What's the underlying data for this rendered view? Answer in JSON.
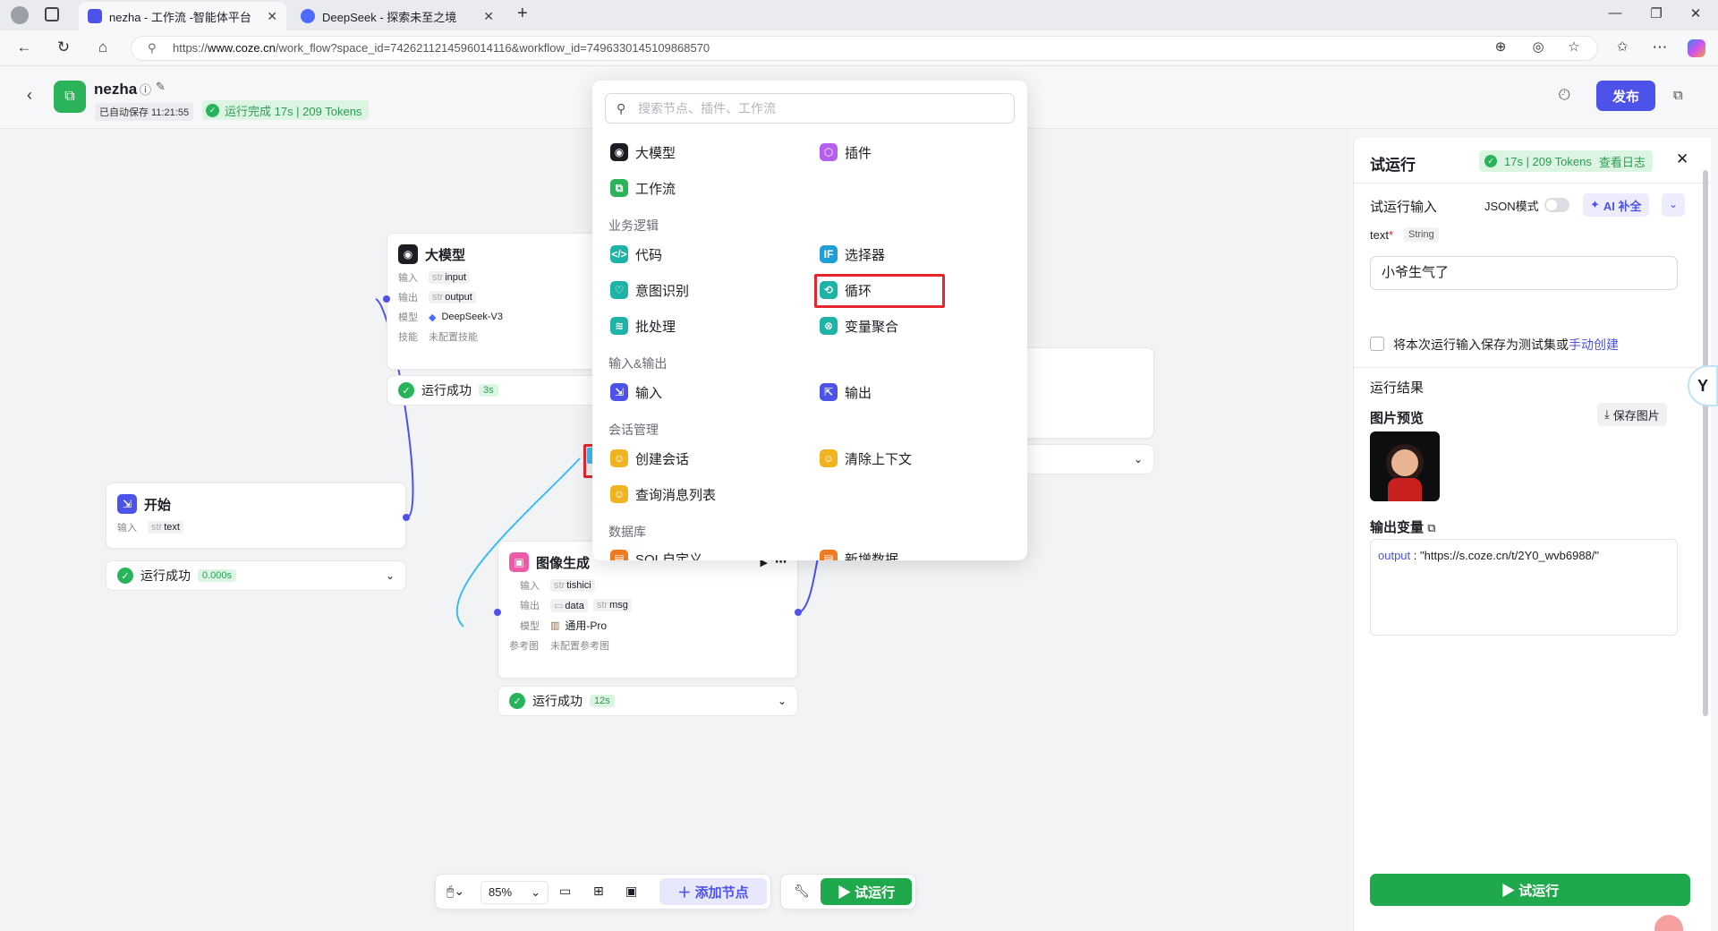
{
  "browser": {
    "tabs": [
      {
        "title": "nezha - 工作流 -智能体平台",
        "active": true
      },
      {
        "title": "DeepSeek - 探索未至之境",
        "active": false
      }
    ],
    "url_prefix": "https://",
    "url_host": "www.coze.cn",
    "url_path": "/work_flow?space_id=7426211214596014116&workflow_id=7496330145109868570"
  },
  "header": {
    "app_name": "nezha",
    "autosave": "已自动保存 11:21:55",
    "run_status": "运行完成 17s | 209 Tokens",
    "publish_label": "发布"
  },
  "nodes": {
    "llm": {
      "title": "大模型",
      "in_label": "输入",
      "in_type": "str",
      "in_var": "input",
      "out_label": "输出",
      "out_type": "str",
      "out_var": "output",
      "model_label": "模型",
      "model": "DeepSeek-V3",
      "skill_label": "技能",
      "skill": "未配置技能",
      "status": "运行成功",
      "time": "3s"
    },
    "start": {
      "title": "开始",
      "in_label": "输入",
      "in_type": "str",
      "in_var": "text",
      "status": "运行成功",
      "time": "0.000s"
    },
    "image": {
      "title": "图像生成",
      "in_label": "输入",
      "in_type": "str",
      "in_var": "tishici",
      "out_label": "输出",
      "out_var1": "data",
      "out_type2": "str",
      "out_var2": "msg",
      "model_label": "模型",
      "model": "通用-Pro",
      "ref_label": "参考图",
      "ref": "未配置参考图",
      "status": "运行成功",
      "time": "12s"
    }
  },
  "popup": {
    "search_placeholder": "搜索节点、插件、工作流",
    "items": {
      "llm": "大模型",
      "plugin": "插件",
      "workflow": "工作流",
      "code": "代码",
      "selector": "选择器",
      "intent": "意图识别",
      "loop": "循环",
      "batch": "批处理",
      "varagg": "变量聚合",
      "input": "输入",
      "output": "输出",
      "create_conv": "创建会话",
      "clear_ctx": "清除上下文",
      "query_msgs": "查询消息列表",
      "sql": "SQL自定义",
      "add_data": "新增数据"
    },
    "sections": {
      "logic": "业务逻辑",
      "io": "输入&输出",
      "conv": "会话管理",
      "db": "数据库"
    }
  },
  "panel": {
    "title": "试运行",
    "badge": "17s | 209 Tokens",
    "view_log": "查看日志",
    "input_section": "试运行输入",
    "json_mode": "JSON模式",
    "ai_fill": "AI 补全",
    "field_name": "text",
    "field_type": "String",
    "field_value": "小爷生气了",
    "save_testset": "将本次运行输入保存为测试集或",
    "manual_create": "手动创建",
    "result_section": "运行结果",
    "image_preview": "图片预览",
    "save_image": "保存图片",
    "output_vars": "输出变量",
    "output_key": "output",
    "output_value": "\"https://s.coze.cn/t/2Y0_wvb6988/\"",
    "run_button": "试运行"
  },
  "toolbar": {
    "zoom": "85%",
    "add_node": "添加节点",
    "test_run": "试运行"
  },
  "colors": {
    "accent": "#4d53e8",
    "success": "#29b35a",
    "highlight_red": "#e5262c"
  }
}
